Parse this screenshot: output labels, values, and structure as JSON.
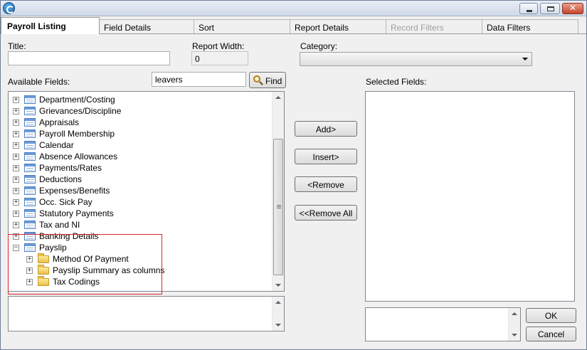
{
  "window": {
    "icon": "app-logo-icon"
  },
  "tabs": [
    {
      "label": "Payroll Listing",
      "active": true
    },
    {
      "label": "Field Details"
    },
    {
      "label": "Sort"
    },
    {
      "label": "Report Details"
    },
    {
      "label": "Record Filters",
      "disabled": true
    },
    {
      "label": "Data Filters"
    }
  ],
  "form": {
    "title_label": "Title:",
    "title_value": "",
    "report_width_label": "Report Width:",
    "report_width_value": "0",
    "category_label": "Category:",
    "category_value": ""
  },
  "available": {
    "label": "Available Fields:",
    "search_value": "leavers",
    "find_label": "Find",
    "items": [
      {
        "label": "Department/Costing",
        "icon": "table-icon",
        "expander": "+"
      },
      {
        "label": "Grievances/Discipline",
        "icon": "table-icon",
        "expander": "+"
      },
      {
        "label": "Appraisals",
        "icon": "table-icon",
        "expander": "+"
      },
      {
        "label": "Payroll Membership",
        "icon": "table-icon",
        "expander": "+"
      },
      {
        "label": "Calendar",
        "icon": "table-icon",
        "expander": "+"
      },
      {
        "label": "Absence Allowances",
        "icon": "table-icon",
        "expander": "+"
      },
      {
        "label": "Payments/Rates",
        "icon": "table-icon",
        "expander": "+"
      },
      {
        "label": "Deductions",
        "icon": "table-icon",
        "expander": "+"
      },
      {
        "label": "Expenses/Benefits",
        "icon": "table-icon",
        "expander": "+"
      },
      {
        "label": "Occ. Sick Pay",
        "icon": "table-icon",
        "expander": "+"
      },
      {
        "label": "Statutory Payments",
        "icon": "table-icon",
        "expander": "+"
      },
      {
        "label": "Tax and NI",
        "icon": "table-icon",
        "expander": "+"
      },
      {
        "label": "Banking Details",
        "icon": "table-icon",
        "expander": "+"
      },
      {
        "label": "Payslip",
        "icon": "table-icon",
        "expander": "−"
      },
      {
        "label": "Method Of Payment",
        "icon": "folder-icon",
        "expander": "+",
        "child": true
      },
      {
        "label": "Payslip Summary as columns",
        "icon": "folder-icon",
        "expander": "+",
        "child": true
      },
      {
        "label": "Tax Codings",
        "icon": "folder-icon",
        "expander": "+",
        "child": true
      }
    ],
    "highlight_color": "#d9262b"
  },
  "actions": {
    "add": "Add>",
    "insert": "Insert>",
    "remove": "<Remove",
    "remove_all": "<<Remove All"
  },
  "selected": {
    "label": "Selected Fields:"
  },
  "dialog": {
    "ok": "OK",
    "cancel": "Cancel"
  }
}
